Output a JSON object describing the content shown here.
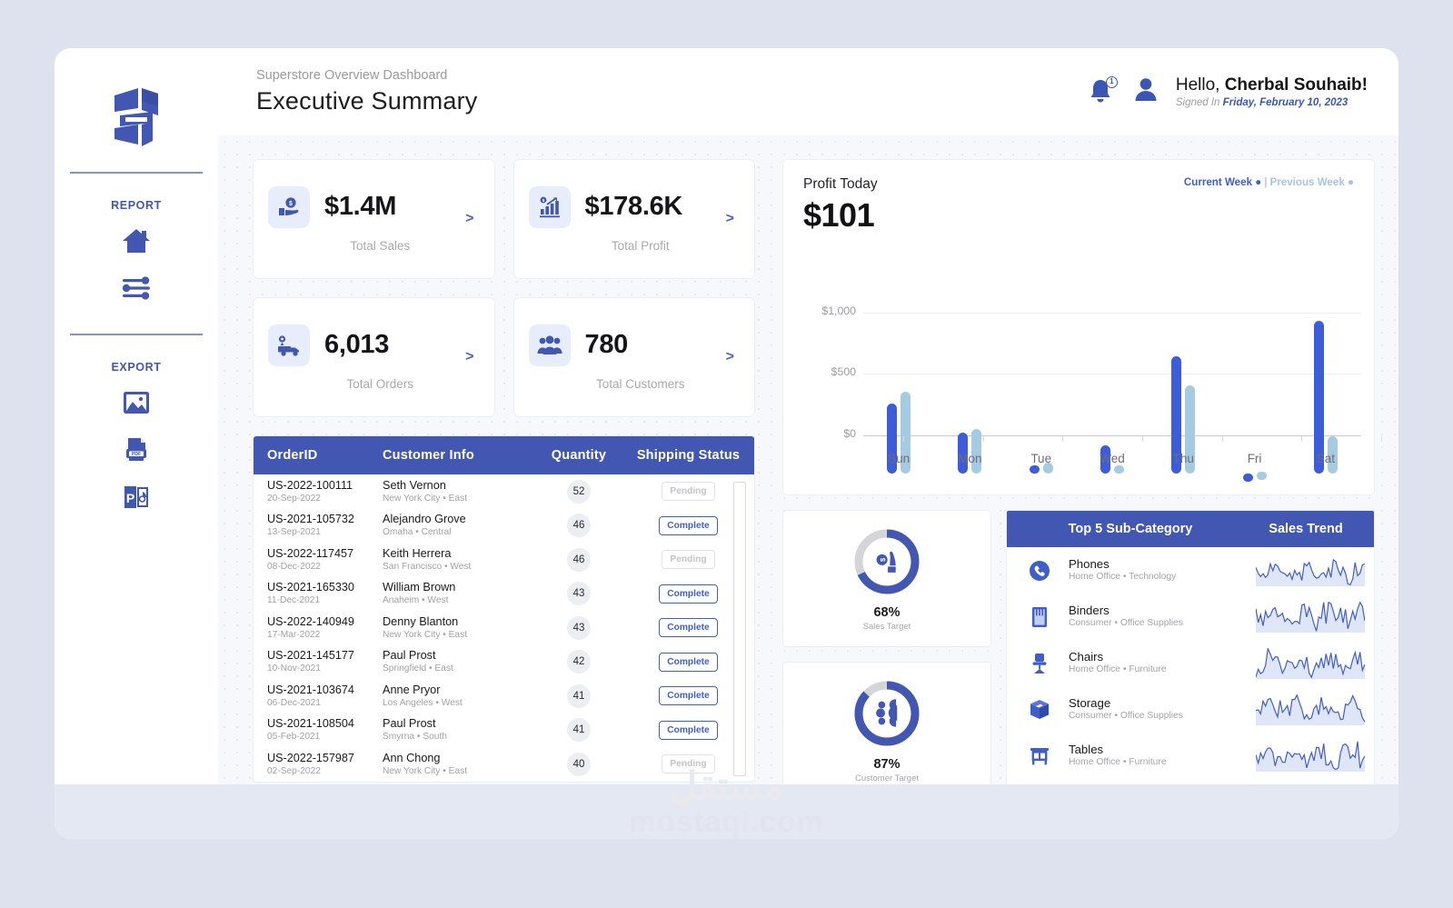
{
  "brand": {
    "logo_icon": "superstore-logo-icon",
    "accent": "#4257b2",
    "accent_bar": "#3d5cdb",
    "accent_light": "#a5cbe3"
  },
  "sidebar": {
    "groups": [
      {
        "title": "REPORT",
        "items": [
          {
            "icon": "home-icon",
            "name": "sidebar-item-home"
          },
          {
            "icon": "filter-sliders-icon",
            "name": "sidebar-item-filters"
          }
        ]
      },
      {
        "title": "EXPORT",
        "items": [
          {
            "icon": "image-export-icon",
            "name": "sidebar-item-export-image"
          },
          {
            "icon": "pdf-export-icon",
            "name": "sidebar-item-export-pdf"
          },
          {
            "icon": "powerpoint-export-icon",
            "name": "sidebar-item-export-ppt"
          }
        ]
      }
    ]
  },
  "header": {
    "subtitle": "Superstore Overview Dashboard",
    "title": "Executive Summary",
    "notification_count": "1",
    "greeting_hello": "Hello,",
    "greeting_name": "Cherbal Souhaib!",
    "signed_in_label": "Signed In",
    "signed_in_date": "Friday, February 10, 2023"
  },
  "kpis": [
    {
      "value": "$1.4M",
      "label": "Total Sales",
      "icon": "money-hand-icon",
      "chevron": ">"
    },
    {
      "value": "$178.6K",
      "label": "Total Profit",
      "icon": "bar-chart-up-icon",
      "chevron": ">"
    },
    {
      "value": "6,013",
      "label": "Total Orders",
      "icon": "delivery-truck-icon",
      "chevron": ">"
    },
    {
      "value": "780",
      "label": "Total Customers",
      "icon": "customers-group-icon",
      "chevron": ">"
    }
  ],
  "orders_table": {
    "columns": [
      "OrderID",
      "Customer Info",
      "Quantity",
      "Shipping Status"
    ],
    "rows": [
      {
        "order_id": "US-2022-100111",
        "date": "20-Sep-2022",
        "customer": "Seth Vernon",
        "location": "New York City • East",
        "quantity": "52",
        "status": "Pending"
      },
      {
        "order_id": "US-2021-105732",
        "date": "13-Sep-2021",
        "customer": "Alejandro Grove",
        "location": "Omaha • Central",
        "quantity": "46",
        "status": "Complete"
      },
      {
        "order_id": "US-2022-117457",
        "date": "08-Dec-2022",
        "customer": "Keith Herrera",
        "location": "San Francisco • West",
        "quantity": "46",
        "status": "Pending"
      },
      {
        "order_id": "US-2021-165330",
        "date": "11-Dec-2021",
        "customer": "William Brown",
        "location": "Anaheim • West",
        "quantity": "43",
        "status": "Complete"
      },
      {
        "order_id": "US-2022-140949",
        "date": "17-Mar-2022",
        "customer": "Denny Blanton",
        "location": "New York City • East",
        "quantity": "43",
        "status": "Complete"
      },
      {
        "order_id": "US-2021-145177",
        "date": "10-Nov-2021",
        "customer": "Paul Prost",
        "location": "Springfield • East",
        "quantity": "42",
        "status": "Complete"
      },
      {
        "order_id": "US-2021-103674",
        "date": "06-Dec-2021",
        "customer": "Anne Pryor",
        "location": "Los Angeles • West",
        "quantity": "41",
        "status": "Complete"
      },
      {
        "order_id": "US-2021-108504",
        "date": "05-Feb-2021",
        "customer": "Paul Prost",
        "location": "Smyrna • South",
        "quantity": "41",
        "status": "Complete"
      },
      {
        "order_id": "US-2022-157987",
        "date": "02-Sep-2022",
        "customer": "Ann Chong",
        "location": "New York City • East",
        "quantity": "40",
        "status": "Pending"
      }
    ]
  },
  "profit_card": {
    "title": "Profit Today",
    "value": "$101",
    "legend_current": "Current Week ●",
    "legend_sep": "|",
    "legend_previous": "Previous Week ●"
  },
  "chart_data": {
    "type": "bar",
    "title": "Profit Today",
    "xlabel": "",
    "ylabel": "",
    "categories": [
      "Sun",
      "Mon",
      "Tue",
      "Wed",
      "Thu",
      "Fri",
      "Sat"
    ],
    "ytick_labels": [
      "$0",
      "$500",
      "$1,000"
    ],
    "yticks": [
      0,
      500,
      1000
    ],
    "ylim": [
      -100,
      1300
    ],
    "grid": true,
    "legend_position": "top-right",
    "series": [
      {
        "name": "Current Week",
        "color": "#3d5cdb",
        "values": [
          570,
          330,
          10,
          230,
          955,
          -70,
          1250
        ]
      },
      {
        "name": "Previous Week",
        "color": "#a5cbe3",
        "values": [
          665,
          360,
          85,
          65,
          720,
          -55,
          300
        ]
      }
    ]
  },
  "gauges": [
    {
      "percent": 68,
      "percent_label": "68%",
      "label": "Sales Target",
      "icon": "money-hand-icon"
    },
    {
      "percent": 87,
      "percent_label": "87%",
      "label": "Customer Target",
      "icon": "customers-group-icon"
    }
  ],
  "subcategory_panel": {
    "columns": [
      "Top 5 Sub-Category",
      "Sales Trend"
    ],
    "rows": [
      {
        "name": "Phones",
        "meta": "Home Office • Technology",
        "icon": "phone-icon"
      },
      {
        "name": "Binders",
        "meta": "Consumer • Office Supplies",
        "icon": "binder-icon"
      },
      {
        "name": "Chairs",
        "meta": "Home Office • Furniture",
        "icon": "chair-icon"
      },
      {
        "name": "Storage",
        "meta": "Consumer • Office Supplies",
        "icon": "box-icon"
      },
      {
        "name": "Tables",
        "meta": "Home Office • Furniture",
        "icon": "table-icon"
      }
    ]
  },
  "watermark": {
    "arabic": "مستقل",
    "latin": "mostaql.com"
  }
}
